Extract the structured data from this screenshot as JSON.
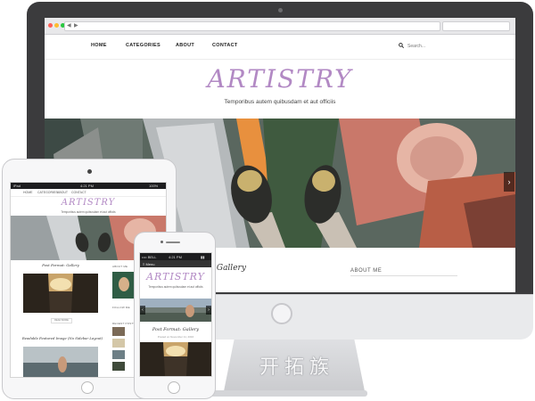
{
  "desktop": {
    "nav": [
      "HOME",
      "CATEGORIES",
      "ABOUT",
      "CONTACT"
    ],
    "search_placeholder": "Search...",
    "site_title": "ARTISTRY",
    "tagline": "Temporibus autem quibusdam et aut officiis",
    "post_title": "at: Gallery",
    "sidebar_heading": "ABOUT ME",
    "slider_next": "›",
    "browser_back": "◀",
    "browser_forward": "▶"
  },
  "tablet": {
    "time": "4:21 PM",
    "carrier": "iPad",
    "battery": "100%",
    "nav": [
      "HOME",
      "CATEGORIES",
      "ABOUT",
      "CONTACT"
    ],
    "site_title": "ARTISTRY",
    "tagline": "Temporibus autem quibusdam et aut officiis",
    "post1_title": "Post Format: Gallery",
    "post2_title": "Readable Featured Image (No Sidebar Layout)",
    "read_more": "READ MORE",
    "sidebar_about": "ABOUT ME",
    "sidebar_follow": "FOLLOW ME",
    "sidebar_recent": "RECENT POSTS"
  },
  "phone": {
    "carrier": "•••• BELL",
    "time": "4:21 PM",
    "battery": "▮▮",
    "menu": "≡ Menu",
    "site_title": "ARTISTRY",
    "tagline": "Temporibus autem quibusdam et aut officiis",
    "post_title": "Post Format: Gallery",
    "post_meta": "Posted on November 11, 2016",
    "prev": "‹",
    "next": "›"
  },
  "watermark": "开拓族",
  "icons": [
    "search-icon",
    "chevron-right-icon",
    "chevron-left-icon",
    "menu-icon"
  ],
  "colors": {
    "brand_title": "#b289c4",
    "bezel": "#3b3b3d",
    "device_frame": "#f7f7f8"
  }
}
